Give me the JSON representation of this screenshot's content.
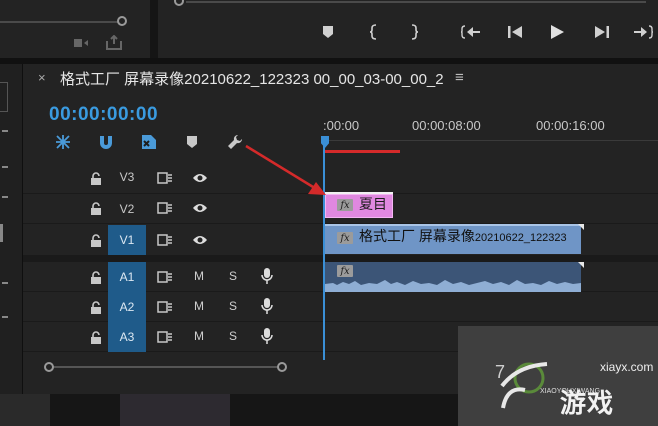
{
  "source_panel": {
    "scroll_label": "",
    "buttons": [
      "insert-icon",
      "export-frame-icon"
    ]
  },
  "program_monitor": {
    "transport": [
      "marker-icon",
      "mark-in-icon",
      "mark-out-icon",
      "go-to-in-icon",
      "step-back-icon",
      "play-icon",
      "step-forward-icon",
      "go-to-out-icon"
    ]
  },
  "sequence": {
    "close_glyph": "×",
    "title": "格式工厂 屏幕录像20210622_122323 00_00_03-00_00_2",
    "menu_glyph": "≡",
    "timecode": "00:00:00:00"
  },
  "ruler": {
    "ticks": [
      ":00:00",
      "00:00:08:00",
      "00:00:16:00"
    ]
  },
  "tracks": {
    "video": [
      {
        "name": "V3",
        "active": false
      },
      {
        "name": "V2",
        "active": false
      },
      {
        "name": "V1",
        "active": true
      }
    ],
    "audio": [
      {
        "name": "A1",
        "active": true,
        "m": "M",
        "s": "S"
      },
      {
        "name": "A2",
        "active": true,
        "m": "M",
        "s": "S"
      },
      {
        "name": "A3",
        "active": true,
        "m": "M",
        "s": "S"
      }
    ]
  },
  "clips": {
    "nest": {
      "fx": "fx",
      "title": "夏目"
    },
    "video": {
      "fx": "fx",
      "title_prefix": "格式工厂 屏幕录像",
      "title_suffix": "20210622_122323"
    },
    "audio": {
      "fx": "fx"
    }
  },
  "watermark": {
    "url": "xiayx.com",
    "big": "游戏",
    "sub": "XIAOYOUXIWANG",
    "num": "7"
  },
  "colors": {
    "accent": "#3a9be0",
    "nest_clip": "#e088e0",
    "video_clip": "#6f95c6",
    "audio_clip": "#3c5577",
    "annotation_red": "#d42a2a"
  }
}
